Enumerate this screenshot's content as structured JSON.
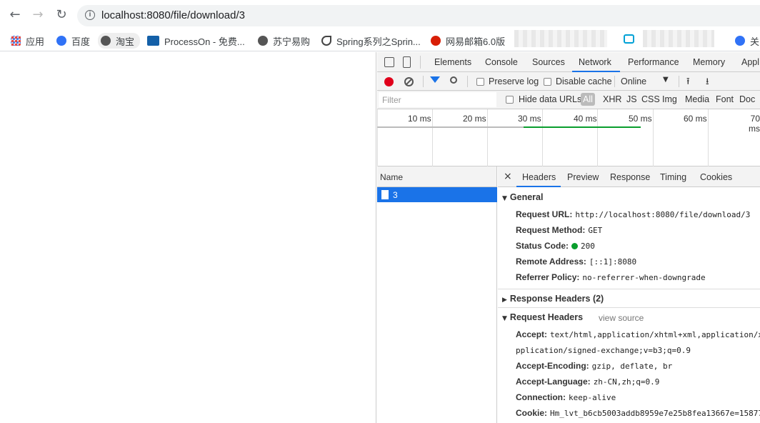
{
  "browser": {
    "url": "localhost:8080/file/download/3",
    "bookmarks": [
      {
        "label": "应用",
        "icon": "apps-grid-icon"
      },
      {
        "label": "百度",
        "icon": "baidu-paw-icon"
      },
      {
        "label": "淘宝",
        "icon": "globe-icon"
      },
      {
        "label": "ProcessOn - 免费...",
        "icon": "processon-icon"
      },
      {
        "label": "苏宁易购",
        "icon": "globe-icon"
      },
      {
        "label": "Spring系列之Sprin...",
        "icon": "spring-icon"
      },
      {
        "label": "网易邮箱6.0版",
        "icon": "netease-icon"
      },
      {
        "label": "关",
        "icon": "baidu-paw-icon"
      }
    ]
  },
  "devtools": {
    "tabs": [
      "Elements",
      "Console",
      "Sources",
      "Network",
      "Performance",
      "Memory",
      "Appl"
    ],
    "active_tab": "Network",
    "toolbar": {
      "preserve_log": "Preserve log",
      "disable_cache": "Disable cache",
      "throttle": "Online"
    },
    "filter": {
      "placeholder": "Filter",
      "hide_data_urls": "Hide data URLs",
      "types": [
        "All",
        "XHR",
        "JS",
        "CSS",
        "Img",
        "Media",
        "Font",
        "Doc"
      ]
    },
    "timeline_labels": [
      "10 ms",
      "20 ms",
      "30 ms",
      "40 ms",
      "50 ms",
      "60 ms",
      "70 ms"
    ],
    "name_header": "Name",
    "requests": [
      {
        "name": "3"
      }
    ],
    "detail_tabs": [
      "Headers",
      "Preview",
      "Response",
      "Timing",
      "Cookies"
    ],
    "general": {
      "title": "General",
      "rows": [
        {
          "k": "Request URL:",
          "v": "http://localhost:8080/file/download/3"
        },
        {
          "k": "Request Method:",
          "v": "GET"
        },
        {
          "k": "Status Code:",
          "v": "200"
        },
        {
          "k": "Remote Address:",
          "v": "[::1]:8080"
        },
        {
          "k": "Referrer Policy:",
          "v": "no-referrer-when-downgrade"
        }
      ]
    },
    "response_headers": {
      "title": "Response Headers (2)"
    },
    "request_headers": {
      "title": "Request Headers",
      "view_source": "view source",
      "rows": [
        {
          "k": "Accept:",
          "v": "text/html,application/xhtml+xml,application/x"
        },
        {
          "k": "",
          "v": "pplication/signed-exchange;v=b3;q=0.9"
        },
        {
          "k": "Accept-Encoding:",
          "v": "gzip, deflate, br"
        },
        {
          "k": "Accept-Language:",
          "v": "zh-CN,zh;q=0.9"
        },
        {
          "k": "Connection:",
          "v": "keep-alive"
        },
        {
          "k": "Cookie:",
          "v": "Hm_lvt_b6cb5003addb8959e7e25b8fea13667e=15877"
        }
      ]
    }
  }
}
